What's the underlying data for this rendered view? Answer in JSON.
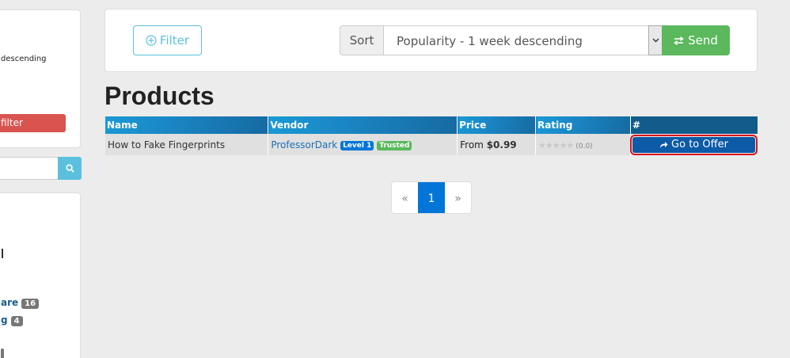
{
  "sidebar": {
    "sort_fragment": "descending",
    "clear_fragment": "filter",
    "categories": [
      {
        "label": "are",
        "count": "16"
      },
      {
        "label": "g",
        "count": "4"
      }
    ]
  },
  "filter_bar": {
    "filter_label": "Filter",
    "sort_label": "Sort",
    "sort_value": "Popularity - 1 week descending",
    "send_label": "Send"
  },
  "page_title": "Products",
  "table": {
    "headers": [
      "Name",
      "Vendor",
      "Price",
      "Rating",
      "#"
    ],
    "rows": [
      {
        "name": "How to Fake Fingerprints",
        "vendor": "ProfessorDark",
        "level_badge": "Level 1",
        "trusted_badge": "Trusted",
        "price_prefix": "From",
        "price": "$0.99",
        "stars": "★★★★★",
        "rating_value": 0.0,
        "rating_text": "(0.0)",
        "action_label": "Go to Offer"
      }
    ]
  },
  "pagination": {
    "prev": "«",
    "current": "1",
    "next": "»"
  },
  "colors": {
    "accent": "#0275d8",
    "danger": "#d9534f",
    "success": "#5cb85c",
    "info": "#5bc0de",
    "highlight": "#d9131a"
  }
}
